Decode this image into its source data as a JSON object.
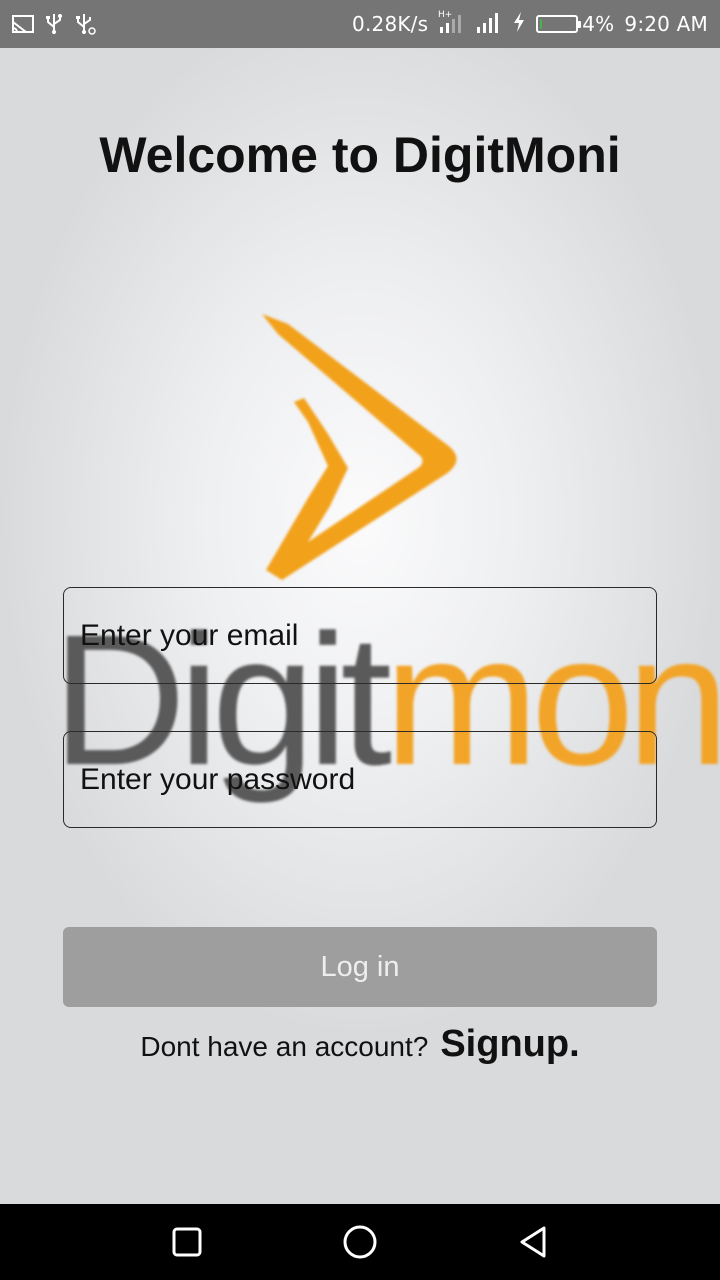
{
  "status_bar": {
    "network_speed": "0.28K/s",
    "network_type": "H+",
    "battery_percent": "4%",
    "battery_level": 0.04,
    "time": "9:20 AM",
    "icons": [
      "screen-cast-icon",
      "usb-icon",
      "usb-debug-icon",
      "signal-icon",
      "signal-icon",
      "charging-icon",
      "battery-icon"
    ]
  },
  "page": {
    "title": "Welcome to DigitMoni"
  },
  "logo": {
    "word_part1": "Digit",
    "word_part2": "moni",
    "colors": {
      "dark": "#5a5a5a",
      "accent": "#f2a428"
    }
  },
  "form": {
    "email_placeholder": "Enter your email",
    "password_placeholder": "Enter your password",
    "login_label": "Log in",
    "signup_prompt": "Dont have an account?",
    "signup_link": "Signup."
  },
  "nav_bar": {
    "icons": [
      "recents-icon",
      "home-icon",
      "back-icon"
    ]
  }
}
